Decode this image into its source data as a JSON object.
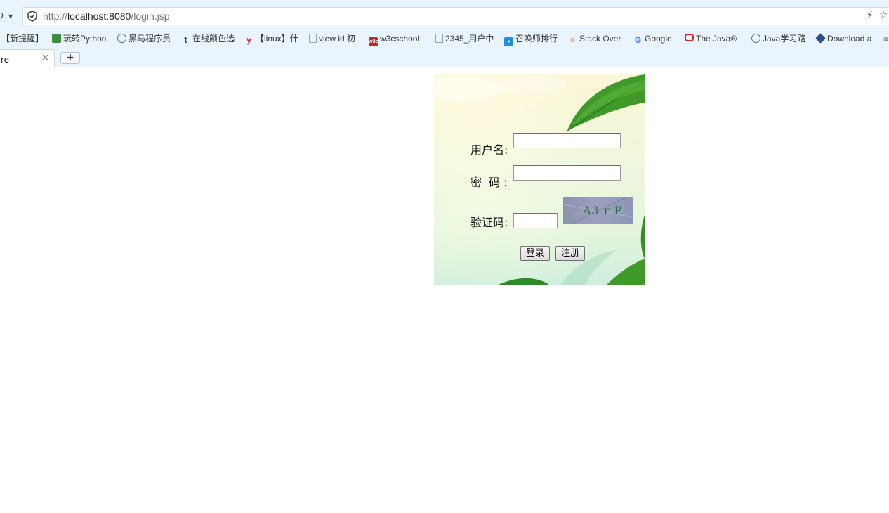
{
  "browser": {
    "url_prefix": "http://",
    "url_host": "localhost:8080",
    "url_path": "/login.jsp",
    "bookmarks": [
      {
        "label": "【新提醒】",
        "icon": "none"
      },
      {
        "label": "玩转Python",
        "icon": "book-icon"
      },
      {
        "label": "黑马程序员",
        "icon": "globe-icon"
      },
      {
        "label": "在线颜色选",
        "icon": "tumblr-icon"
      },
      {
        "label": "【linux】什",
        "icon": "y-icon"
      },
      {
        "label": "view id 初",
        "icon": "page-icon"
      },
      {
        "label": "w3cschool",
        "icon": "w3c-icon"
      },
      {
        "label": "2345_用户中",
        "icon": "page-icon"
      },
      {
        "label": "召唤师排行",
        "icon": "lol-icon"
      },
      {
        "label": "Stack Over",
        "icon": "stackoverflow-icon"
      },
      {
        "label": "Google",
        "icon": "google-icon"
      },
      {
        "label": "The Java®",
        "icon": "oracle-icon"
      },
      {
        "label": "Java学习路",
        "icon": "globe-icon"
      },
      {
        "label": "Download a",
        "icon": "cube-icon"
      }
    ],
    "tab": {
      "title": "re",
      "close": "×",
      "new_tab": "+"
    }
  },
  "login": {
    "username_label": "用户名:",
    "username_value": "",
    "password_label": "密  码 :",
    "password_value": "",
    "captcha_label": "验证码:",
    "captcha_value": "",
    "captcha_text": "A3 r P",
    "login_button": "登录",
    "register_button": "注册"
  },
  "colors": {
    "chrome_bg": "#eaf4fc",
    "captcha_bg": "#959bb8",
    "captcha_text": "#24723a",
    "leaf_green": "#3f9a2a"
  }
}
